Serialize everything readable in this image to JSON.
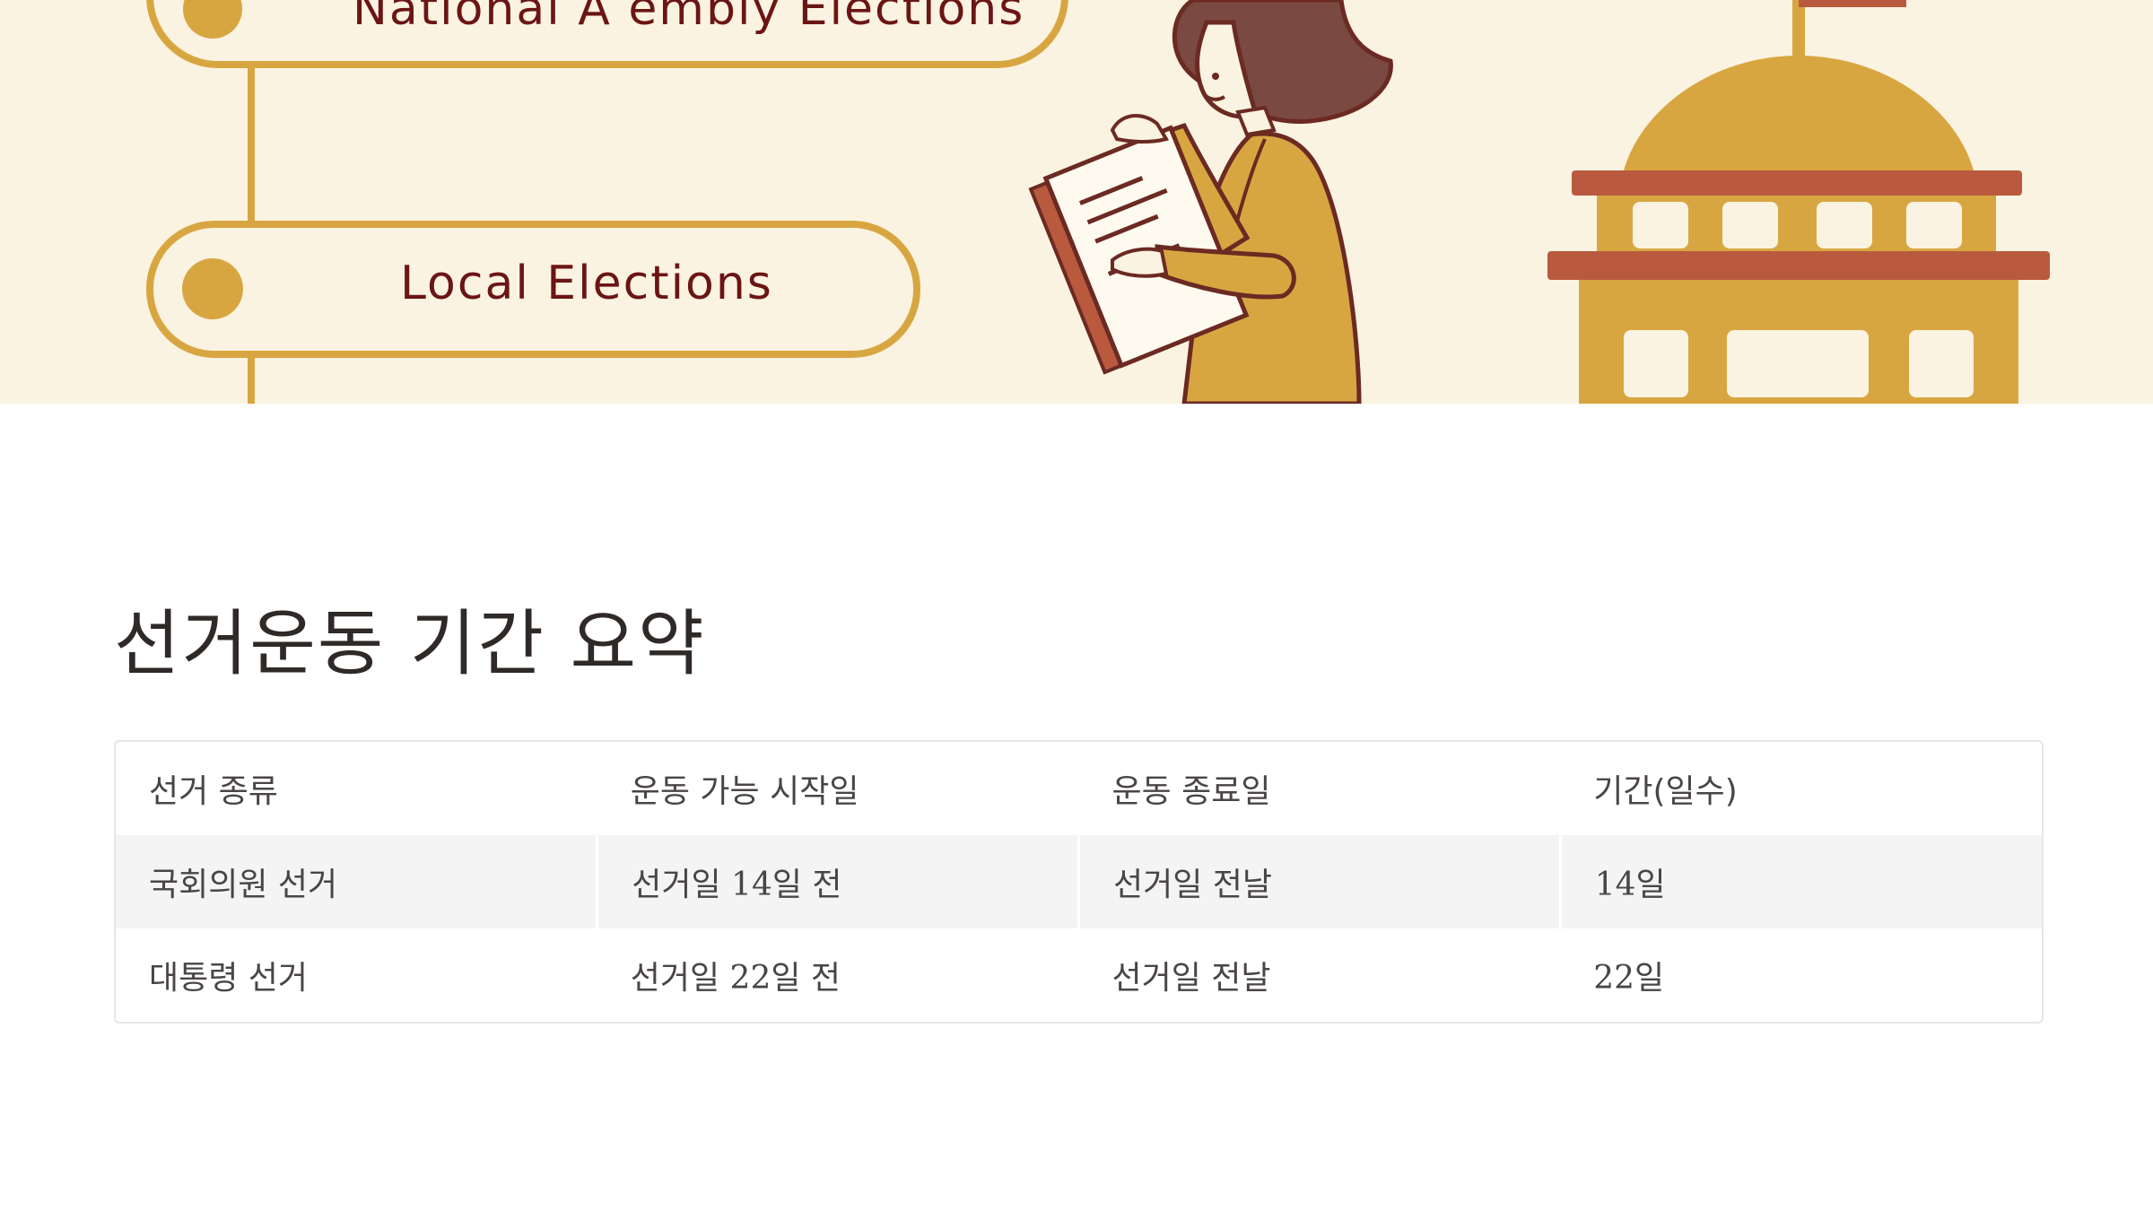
{
  "hero": {
    "timeline_items": [
      {
        "label": "National A   embly Elections"
      },
      {
        "label": "Local Elections"
      }
    ],
    "colors": {
      "background": "#fbf3e1",
      "mustard": "#d8a641",
      "maroon": "#6b1515",
      "brick": "#b95a3e",
      "hair": "#7a4a42"
    }
  },
  "page": {
    "title": "선거운동 기간 요약"
  },
  "table": {
    "headers": [
      "선거 종류",
      "운동 가능 시작일",
      "운동 종료일",
      "기간(일수)"
    ],
    "rows": [
      [
        "국회의원 선거",
        "선거일 14일 전",
        "선거일 전날",
        "14일"
      ],
      [
        "대통령 선거",
        "선거일 22일 전",
        "선거일 전날",
        "22일"
      ]
    ]
  }
}
